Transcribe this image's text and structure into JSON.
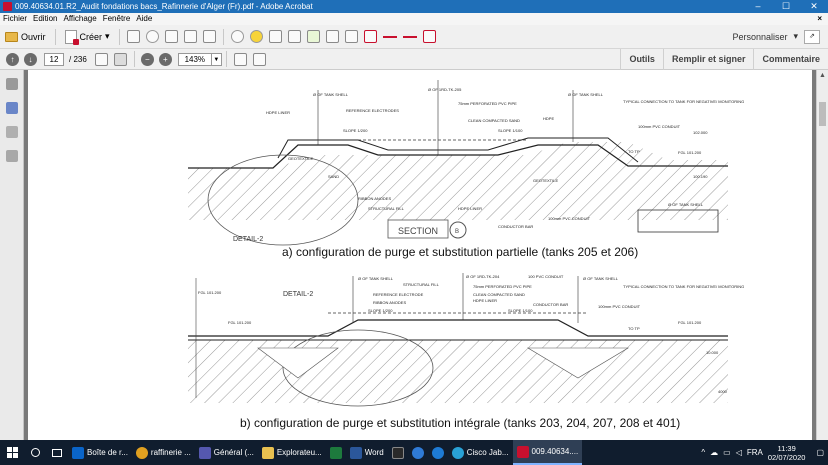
{
  "window": {
    "title": "009.40634.01.R2_Audit fondations bacs_Rafinnerie d'Alger (Fr).pdf - Adobe Acrobat",
    "minimize": "–",
    "maximize": "☐",
    "close": "✕"
  },
  "menu": {
    "items": [
      "Fichier",
      "Edition",
      "Affichage",
      "Fenêtre",
      "Aide"
    ],
    "close": "×"
  },
  "toolbar1": {
    "open_label": "Ouvrir",
    "create_label": "Créer",
    "create_arrow": "▾",
    "customize_label": "Personnaliser",
    "customize_arrow": "▾"
  },
  "toolbar2": {
    "page_current": "12",
    "page_total": "/ 236",
    "zoom_value": "143%",
    "links": [
      "Outils",
      "Remplir et signer",
      "Commentaire"
    ]
  },
  "document": {
    "caption_a": "a) configuration de purge et substitution partielle (tanks 205 et 206)",
    "caption_b": "b) configuration de purge et substitution intégrale (tanks 203, 204, 207, 208 et 401)",
    "labels_a": [
      "Ø OF TANK SHELL",
      "Ø OF 1RD-TK-205",
      "Ø OF TANK SHELL",
      "HDPE LINER",
      "REFERENCE ELECTRODES",
      "75mm PERFORATED PVC PIPE",
      "TYPICAL CONNECTION TO TANK FOR NEGATIVE/ MONITORING",
      "SLOPE 1/200",
      "CLEAN COMPACTED SAND",
      "HDPE",
      "SLOPE 1/100",
      "100mm PVC CONDUIT",
      "GEOTEXTILE",
      "RIBBON ANODES",
      "STRUCTURAL FILL",
      "HDPE LINER",
      "GEOTEXTILE",
      "TO TP",
      "FGL 101.200",
      "SAND",
      "DETAIL-2",
      "SECTION",
      "B",
      "100mm PVC CONDUIT",
      "CONDUCTOR BAR",
      "Ø OF TANK SHELL",
      "102.000",
      "100.190"
    ],
    "labels_b": [
      "Ø OF TANK SHELL",
      "STRUCTURAL FILL",
      "Ø OF 1RD-TK-204",
      "100 PVC CONDUIT",
      "Ø OF TANK SHELL",
      "FGL 101.200",
      "REFERENCE ELECTRODE",
      "75mm PERFORATED PVC PIPE",
      "TYPICAL CONNECTION TO TANK FOR NEGATIVE/ MONITORING",
      "DETAIL-2",
      "RIBBON ANODES",
      "CLEAN COMPACTED SAND",
      "HDPE LINER",
      "SLOPE 1/200",
      "SLOPE 1/100",
      "CONDUCTOR BAR",
      "100mm PVC CONDUIT",
      "FGL 101.200",
      "FGL 101.200",
      "TO TP",
      "4000",
      "10.000"
    ]
  },
  "taskbar": {
    "items": [
      {
        "label": "Boîte de r...",
        "color": "#0a64c8"
      },
      {
        "label": "raffinerie ...",
        "color": "#e0a020"
      },
      {
        "label": "Général (...",
        "color": "#5558af"
      },
      {
        "label": "Explorateu...",
        "color": "#e8c050"
      },
      {
        "label": "",
        "color": "#1d7a3d"
      },
      {
        "label": "Word",
        "color": "#2b579a"
      },
      {
        "label": "",
        "color": "#2a2a2a"
      },
      {
        "label": "",
        "color": "#2f7bd6"
      },
      {
        "label": "",
        "color": "#1e7bd4"
      },
      {
        "label": "Cisco Jab...",
        "color": "#29a1d6"
      },
      {
        "label": "009.40634....",
        "color": "#c8102e"
      }
    ],
    "tray_lang": "FRA",
    "time": "11:39",
    "date": "02/07/2020"
  },
  "colors": {
    "titlebar": "#1f6fb8",
    "taskbar": "#101d2e",
    "acrobat_red": "#c8102e"
  }
}
